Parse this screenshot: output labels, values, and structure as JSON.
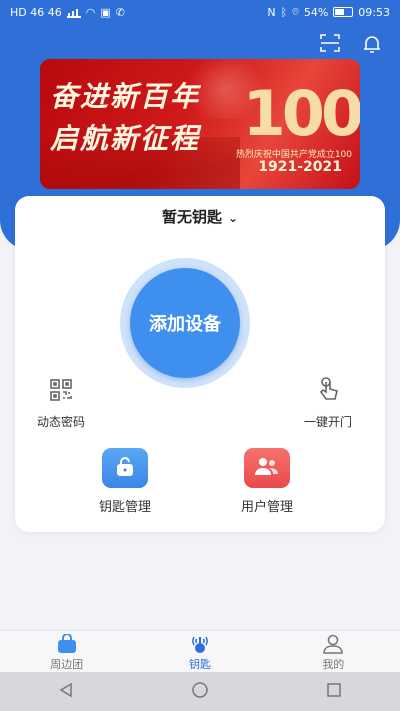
{
  "status_bar": {
    "left_text": "HD 46 46",
    "battery": "54%",
    "time": "09:53"
  },
  "header": {
    "scan_icon": "scan-icon",
    "bell_icon": "bell-icon"
  },
  "banner": {
    "slogan_line1": "奋进新百年",
    "slogan_line2": "启航新征程",
    "number": "100",
    "anniversary_text": "热烈庆祝中国共产党成立100",
    "years": "1921-2021"
  },
  "card": {
    "key_selector": "暂无钥匙",
    "add_device_label": "添加设备",
    "dynamic_password_label": "动态密码",
    "one_key_open_label": "一键开门",
    "key_manage_label": "钥匙管理",
    "user_manage_label": "用户管理"
  },
  "tabbar": {
    "tabs": [
      {
        "label": "周边团",
        "icon": "bag-icon"
      },
      {
        "label": "钥匙",
        "icon": "key-signal-icon",
        "active": true
      },
      {
        "label": "我的",
        "icon": "person-icon"
      }
    ]
  },
  "colors": {
    "primary_blue": "#2e6fd8",
    "button_blue": "#3f90ee",
    "user_red": "#f05454"
  }
}
